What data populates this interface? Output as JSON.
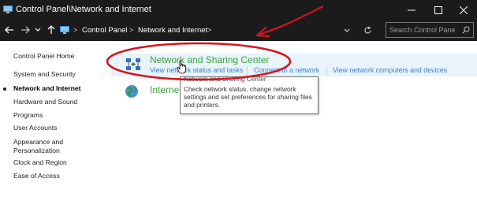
{
  "window": {
    "title": "Control Panel\\Network and Internet",
    "controls": [
      "minimize-icon",
      "maximize-icon",
      "close-icon"
    ]
  },
  "address_bar": {
    "crumbs": [
      "Control Panel",
      "Network and Internet"
    ],
    "search_placeholder": "Search Control Panel"
  },
  "sidebar": {
    "items": [
      {
        "label": "Control Panel Home",
        "active": false
      },
      {
        "label": "System and Security",
        "active": false
      },
      {
        "label": "Network and Internet",
        "active": true
      },
      {
        "label": "Hardware and Sound",
        "active": false
      },
      {
        "label": "Programs",
        "active": false
      },
      {
        "label": "User Accounts",
        "active": false
      },
      {
        "label": "Appearance and",
        "active": false
      },
      {
        "label": "Personalization",
        "active": false
      },
      {
        "label": "Clock and Region",
        "active": false
      },
      {
        "label": "Ease of Access",
        "active": false
      }
    ]
  },
  "categories": [
    {
      "title": "Network and Sharing Center",
      "links": [
        "View network status and tasks",
        "Connect to a network",
        "View network computers and devices"
      ]
    },
    {
      "title": "Internet Options",
      "links": []
    }
  ],
  "tooltip": {
    "title": "Network and Sharing Center",
    "body": "Check network status, change network settings and set preferences for sharing files and printers."
  },
  "annotation": {
    "color": "#d6121c"
  }
}
